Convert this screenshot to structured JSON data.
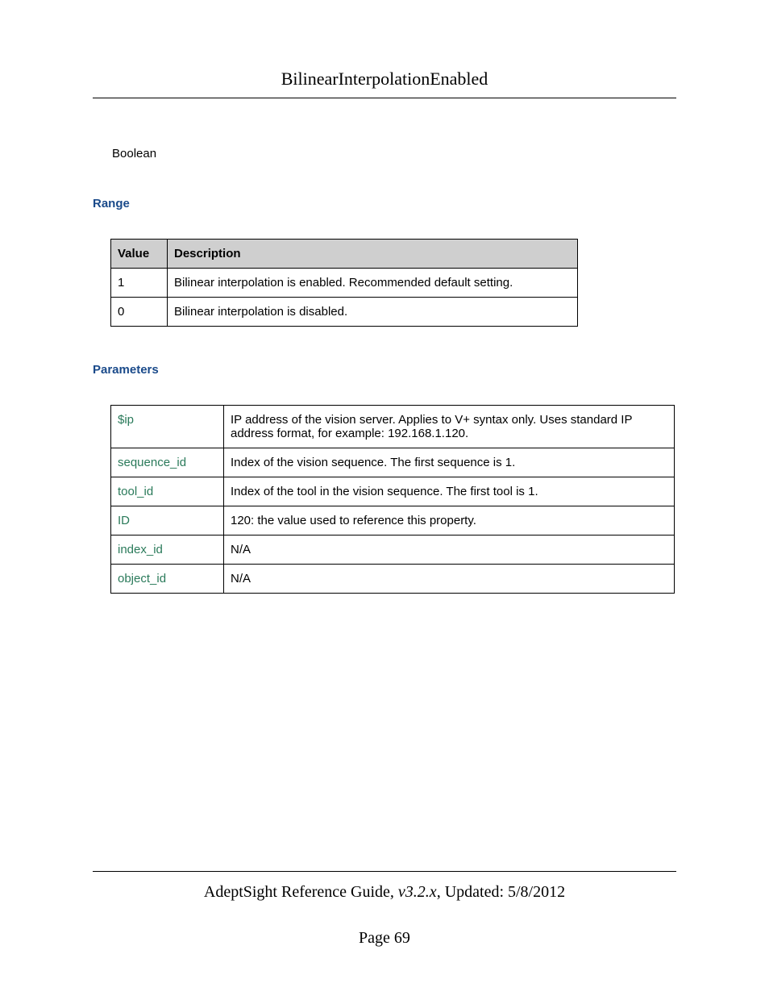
{
  "header": {
    "title": "BilinearInterpolationEnabled"
  },
  "type_text": "Boolean",
  "range": {
    "heading": "Range",
    "headers": {
      "value": "Value",
      "description": "Description"
    },
    "rows": [
      {
        "value": "1",
        "description": "Bilinear interpolation is enabled. Recommended default setting."
      },
      {
        "value": "0",
        "description": "Bilinear interpolation is disabled."
      }
    ]
  },
  "parameters": {
    "heading": "Parameters",
    "rows": [
      {
        "name": "$ip",
        "description": "IP address of the vision server. Applies to V+ syntax only. Uses standard IP address format, for example: 192.168.1.120."
      },
      {
        "name": "sequence_id",
        "description": "Index of the vision sequence. The first sequence is 1."
      },
      {
        "name": "tool_id",
        "description": "Index of the tool in the vision sequence. The first tool is 1."
      },
      {
        "name": "ID",
        "description": "120: the value used to reference this property."
      },
      {
        "name": "index_id",
        "description": "N/A"
      },
      {
        "name": "object_id",
        "description": "N/A"
      }
    ]
  },
  "footer": {
    "guide": "AdeptSight Reference Guide",
    "version": ", v3.2.x",
    "updated": ", Updated: 5/8/2012",
    "page": "Page 69"
  }
}
